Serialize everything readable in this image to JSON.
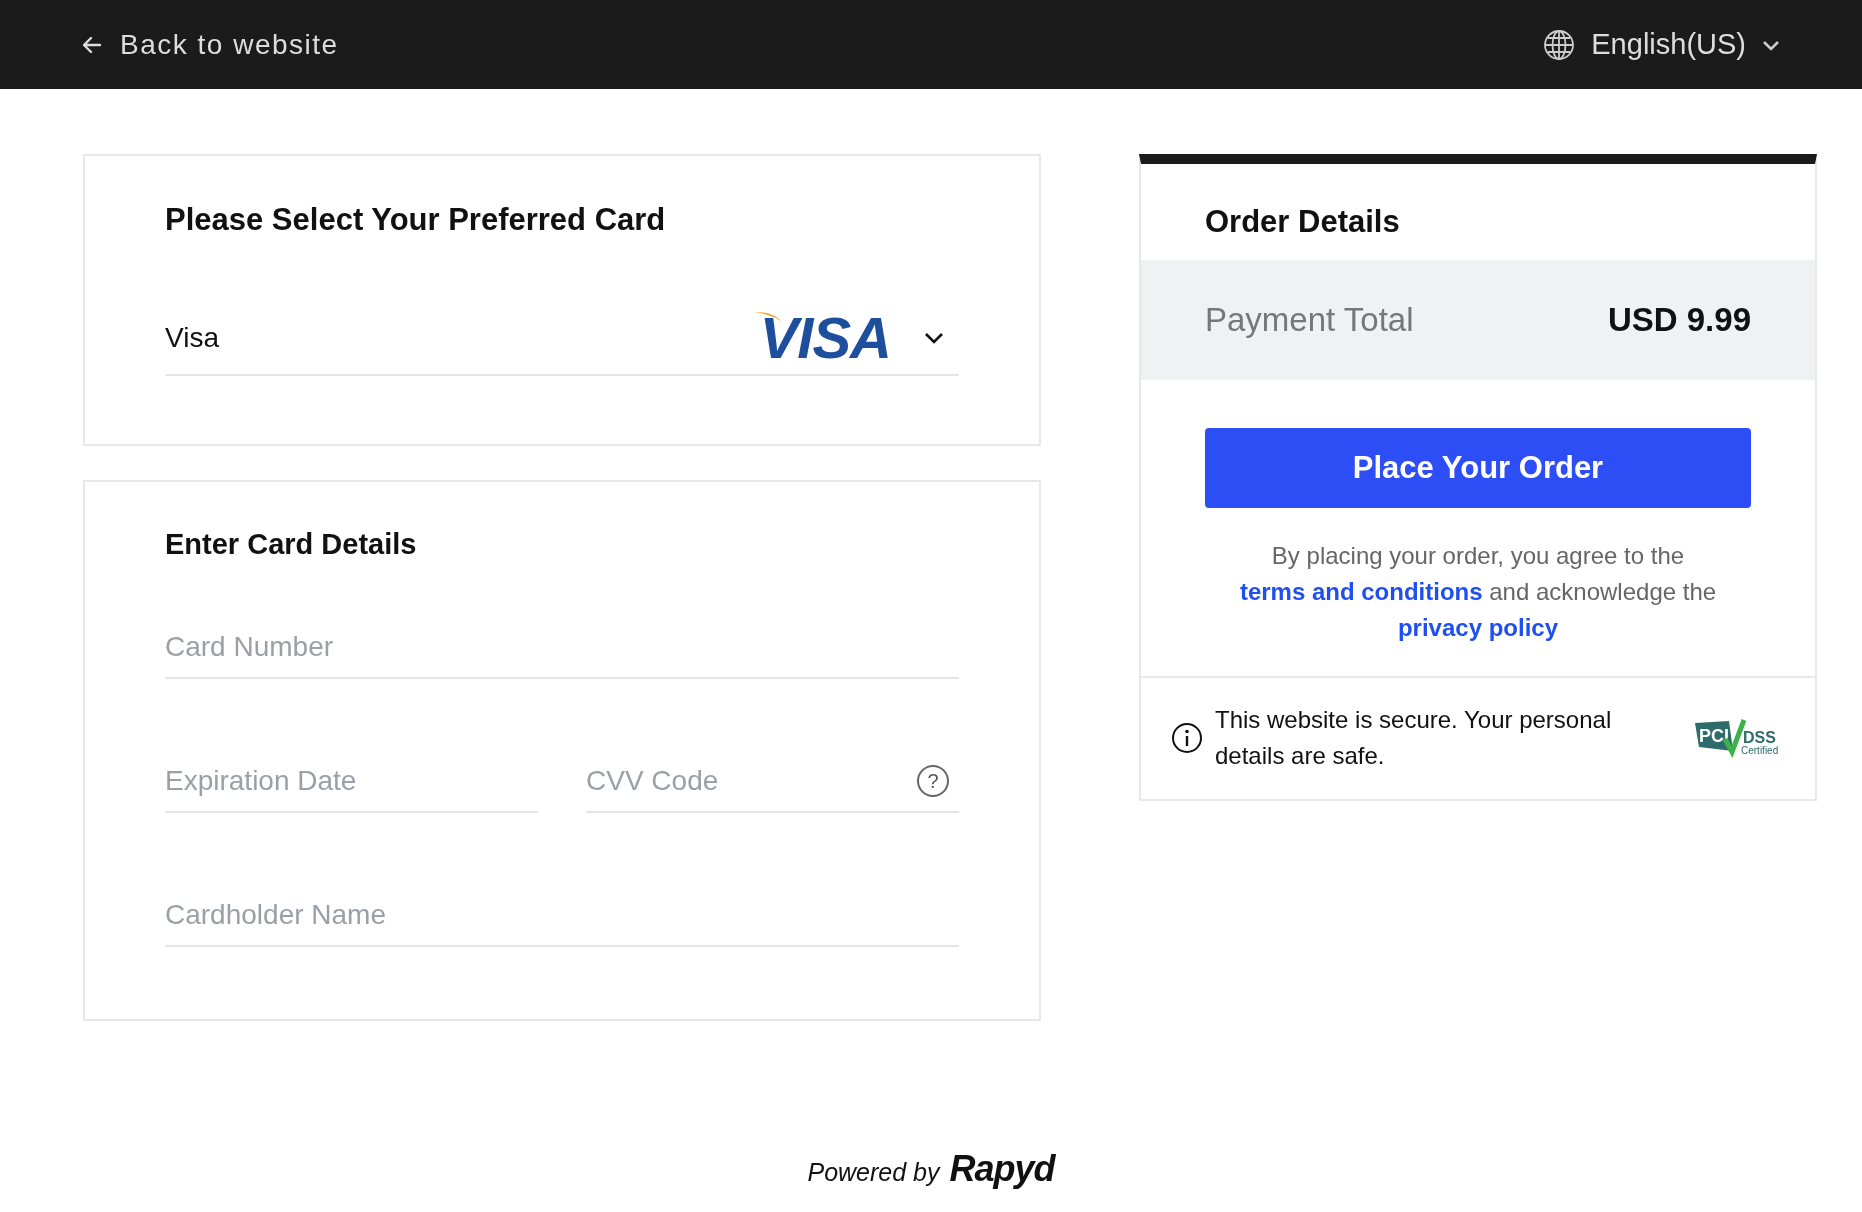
{
  "header": {
    "back_link": "Back to website",
    "language": "English(US)"
  },
  "card_select": {
    "title": "Please Select Your Preferred Card",
    "selected_card": "Visa",
    "logo_text": "VISA"
  },
  "card_details": {
    "title": "Enter Card Details",
    "fields": [
      {
        "kind": "full",
        "placeholder": "Card Number"
      },
      {
        "kind": "half",
        "placeholder": "Expiration Date"
      },
      {
        "kind": "help",
        "placeholder": "CVV Code",
        "help_icon": "?"
      },
      {
        "kind": "full",
        "placeholder": "Cardholder Name"
      }
    ]
  },
  "order": {
    "title": "Order Details",
    "total_label": "Payment Total",
    "total_value": "USD 9.99",
    "button": "Place Your Order",
    "agreement": [
      "By placing your order, you agree to the ",
      "terms and conditions",
      " and acknowledge the ",
      "privacy policy"
    ],
    "secure_note": "This website is secure. Your personal details are safe.",
    "badge": {
      "left": "PCI",
      "right": "DSS",
      "sub": "Certified"
    }
  },
  "footer": {
    "powered_by": "Powered by",
    "brand": "Rapyd"
  }
}
